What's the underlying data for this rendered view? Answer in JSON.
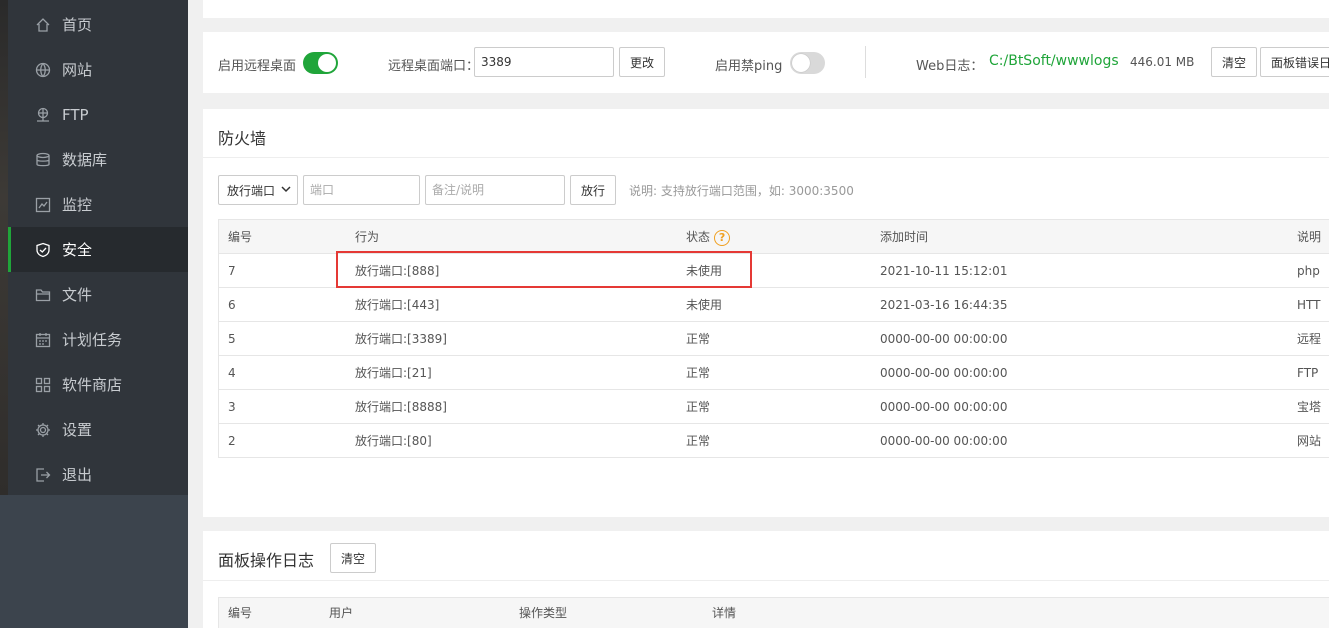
{
  "sidebar": {
    "items": [
      {
        "label": "首页",
        "icon": "home-icon"
      },
      {
        "label": "网站",
        "icon": "globe-icon"
      },
      {
        "label": "FTP",
        "icon": "ftp-icon"
      },
      {
        "label": "数据库",
        "icon": "database-icon"
      },
      {
        "label": "监控",
        "icon": "monitor-icon"
      },
      {
        "label": "安全",
        "icon": "shield-icon",
        "active": true
      },
      {
        "label": "文件",
        "icon": "folder-icon"
      },
      {
        "label": "计划任务",
        "icon": "calendar-icon"
      },
      {
        "label": "软件商店",
        "icon": "grid-icon"
      },
      {
        "label": "设置",
        "icon": "gear-icon"
      },
      {
        "label": "退出",
        "icon": "logout-icon"
      }
    ]
  },
  "settings": {
    "remote_desktop_label": "启用远程桌面",
    "remote_desktop_on": true,
    "port_label": "远程桌面端口：",
    "port_value": "3389",
    "change_button": "更改",
    "ping_label": "启用禁ping",
    "ping_on": false,
    "weblog_label": "Web日志：",
    "weblog_path": "C:/BtSoft/wwwlogs",
    "weblog_size": "446.01 MB",
    "clear_button": "清空",
    "panel_error_button": "面板错误日"
  },
  "firewall": {
    "title": "防火墙",
    "select_value": "放行端口",
    "port_placeholder": "端口",
    "note_placeholder": "备注/说明",
    "allow_button": "放行",
    "hint": "说明: 支持放行端口范围，如: 3000:3500",
    "headers": {
      "id": "编号",
      "action": "行为",
      "status": "状态",
      "time": "添加时间",
      "note": "说明"
    },
    "rows": [
      {
        "id": "7",
        "action": "放行端口:[888]",
        "status": "未使用",
        "time": "2021-10-11 15:12:01",
        "note": "php"
      },
      {
        "id": "6",
        "action": "放行端口:[443]",
        "status": "未使用",
        "time": "2021-03-16 16:44:35",
        "note": "HTT"
      },
      {
        "id": "5",
        "action": "放行端口:[3389]",
        "status": "正常",
        "time": "0000-00-00 00:00:00",
        "note": "远程"
      },
      {
        "id": "4",
        "action": "放行端口:[21]",
        "status": "正常",
        "time": "0000-00-00 00:00:00",
        "note": "FTP"
      },
      {
        "id": "3",
        "action": "放行端口:[8888]",
        "status": "正常",
        "time": "0000-00-00 00:00:00",
        "note": "宝塔"
      },
      {
        "id": "2",
        "action": "放行端口:[80]",
        "status": "正常",
        "time": "0000-00-00 00:00:00",
        "note": "网站"
      }
    ]
  },
  "log": {
    "title": "面板操作日志",
    "clear_button": "清空",
    "headers": {
      "id": "编号",
      "user": "用户",
      "type": "操作类型",
      "detail": "详情"
    }
  },
  "colors": {
    "accent": "#20a53a",
    "highlight": "#e53935",
    "sidebar": "#30353b"
  }
}
